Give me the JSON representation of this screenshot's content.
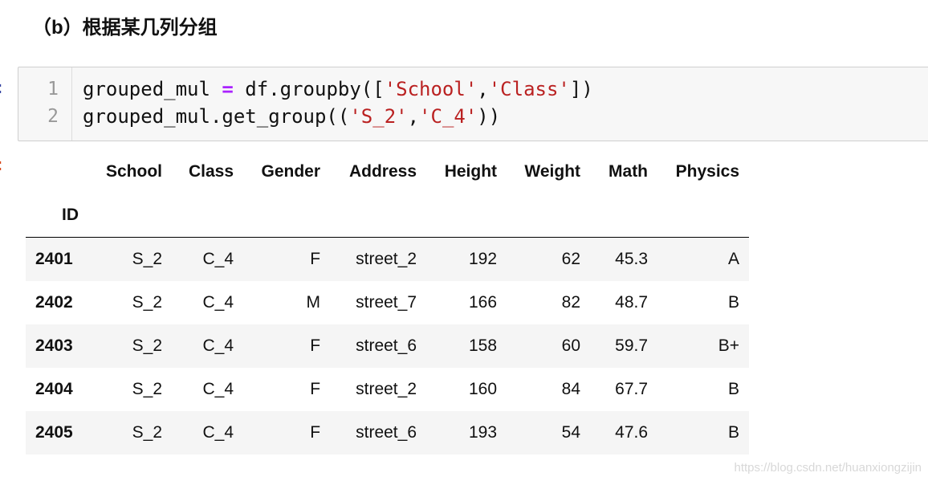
{
  "heading": "（b）根据某几列分组",
  "code_cell": {
    "line_numbers": [
      "1",
      "2"
    ],
    "lines": [
      [
        {
          "t": "grouped_mul ",
          "k": "plain"
        },
        {
          "t": "=",
          "k": "op"
        },
        {
          "t": " df.groupby([",
          "k": "plain"
        },
        {
          "t": "'School'",
          "k": "str"
        },
        {
          "t": ",",
          "k": "plain"
        },
        {
          "t": "'Class'",
          "k": "str"
        },
        {
          "t": "])",
          "k": "plain"
        }
      ],
      [
        {
          "t": "grouped_mul.get_group((",
          "k": "plain"
        },
        {
          "t": "'S_2'",
          "k": "str"
        },
        {
          "t": ",",
          "k": "plain"
        },
        {
          "t": "'C_4'",
          "k": "str"
        },
        {
          "t": "))",
          "k": "plain"
        }
      ]
    ]
  },
  "output_table": {
    "columns": [
      "School",
      "Class",
      "Gender",
      "Address",
      "Height",
      "Weight",
      "Math",
      "Physics"
    ],
    "index_name": "ID",
    "rows": [
      {
        "id": "2401",
        "cells": [
          "S_2",
          "C_4",
          "F",
          "street_2",
          "192",
          "62",
          "45.3",
          "A"
        ]
      },
      {
        "id": "2402",
        "cells": [
          "S_2",
          "C_4",
          "M",
          "street_7",
          "166",
          "82",
          "48.7",
          "B"
        ]
      },
      {
        "id": "2403",
        "cells": [
          "S_2",
          "C_4",
          "F",
          "street_6",
          "158",
          "60",
          "59.7",
          "B+"
        ]
      },
      {
        "id": "2404",
        "cells": [
          "S_2",
          "C_4",
          "F",
          "street_2",
          "160",
          "84",
          "67.7",
          "B"
        ]
      },
      {
        "id": "2405",
        "cells": [
          "S_2",
          "C_4",
          "F",
          "street_6",
          "193",
          "54",
          "47.6",
          "B"
        ]
      }
    ]
  },
  "watermark": "https://blog.csdn.net/huanxiongzijin",
  "colors": {
    "keyword_op": "#aa22ff",
    "string": "#ba2121",
    "input_prompt": "#303f9f",
    "output_prompt": "#d84315"
  }
}
